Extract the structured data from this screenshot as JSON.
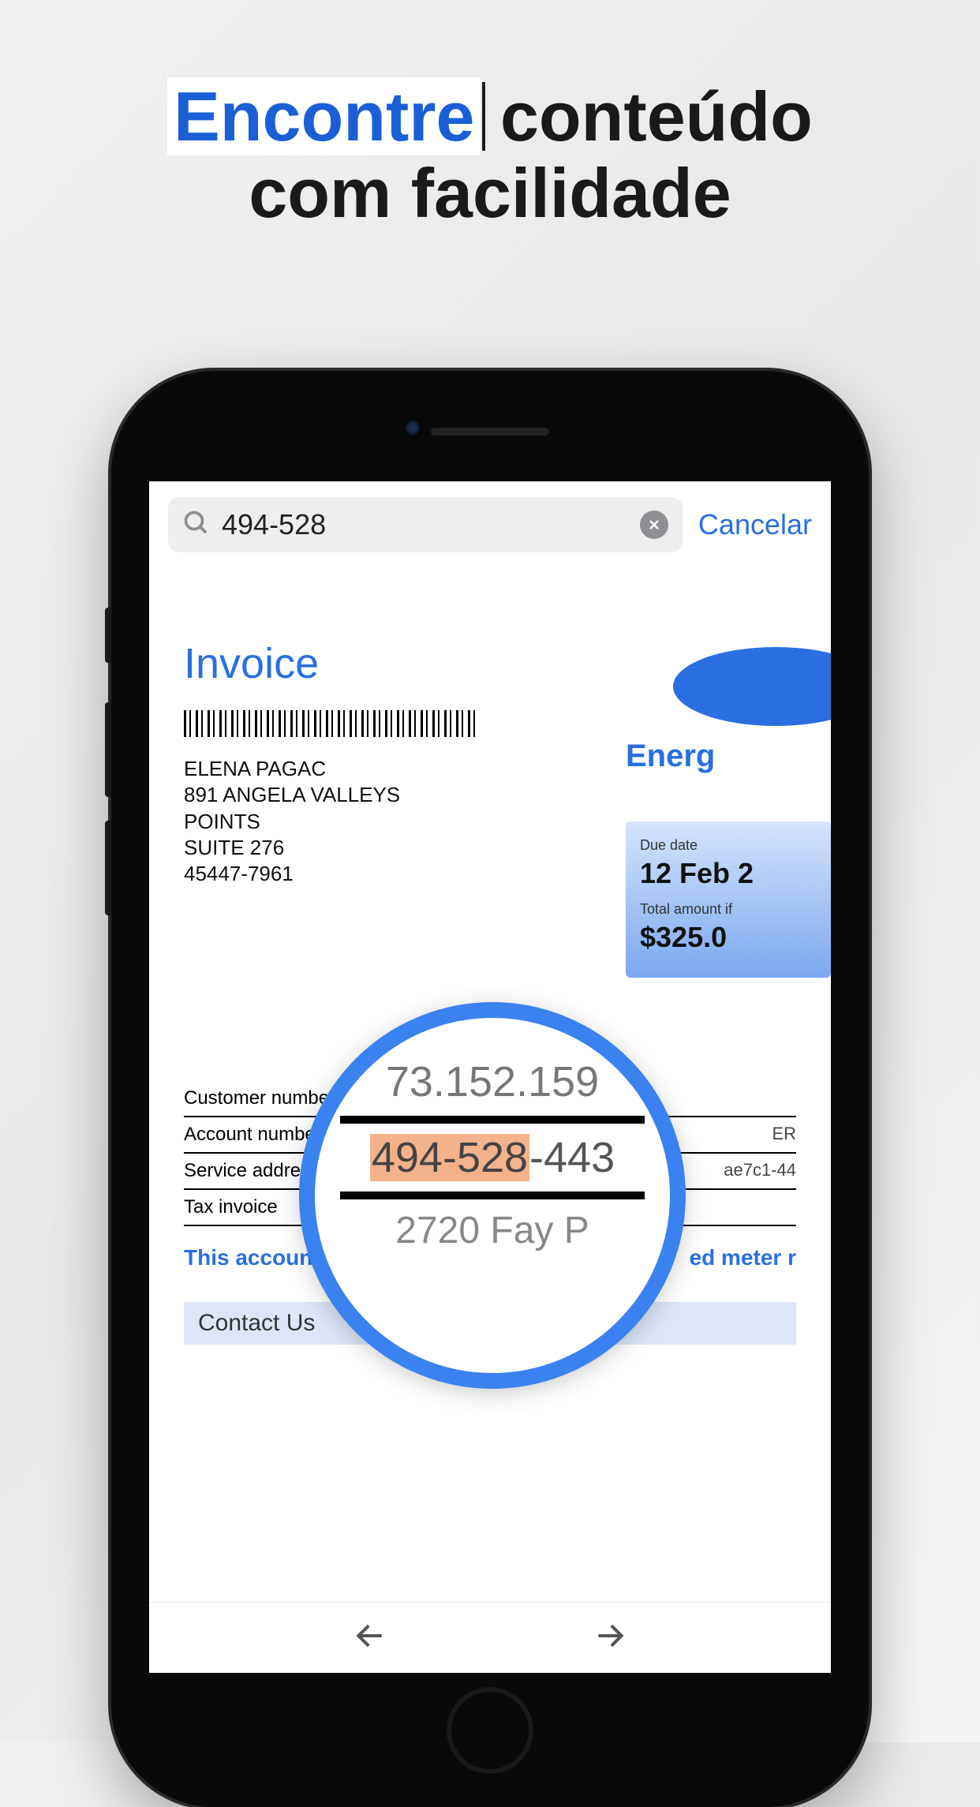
{
  "headline": {
    "highlight": "Encontre",
    "rest1": "conteúdo",
    "line2": "com facilidade"
  },
  "search": {
    "value": "494-528",
    "cancel": "Cancelar"
  },
  "document": {
    "invoice_title": "Invoice",
    "address": {
      "name": "ELENA PAGAC",
      "line1": "891 ANGELA VALLEYS",
      "line2": "POINTS",
      "line3": "SUITE 276",
      "zip": "45447-7961"
    },
    "brand_partial": "Energ",
    "due": {
      "label": "Due date",
      "value": "12 Feb 2",
      "total_label": "Total amount if",
      "total_value": "$325.0"
    },
    "rows": {
      "r1_label": "Customer number",
      "r2_label": "Account number",
      "r2_val_suffix": "ER",
      "r3_label": "Service address",
      "r3_val_suffix": "ae7c1-44",
      "r4_label": "Tax invoice"
    },
    "msg_left": "This account is",
    "msg_right": "ed meter r",
    "contact": "Contact Us"
  },
  "lens": {
    "top": "73.152.159",
    "match_prefix": "494-528",
    "match_suffix": "-443",
    "bottom": "2720 Fay P"
  }
}
